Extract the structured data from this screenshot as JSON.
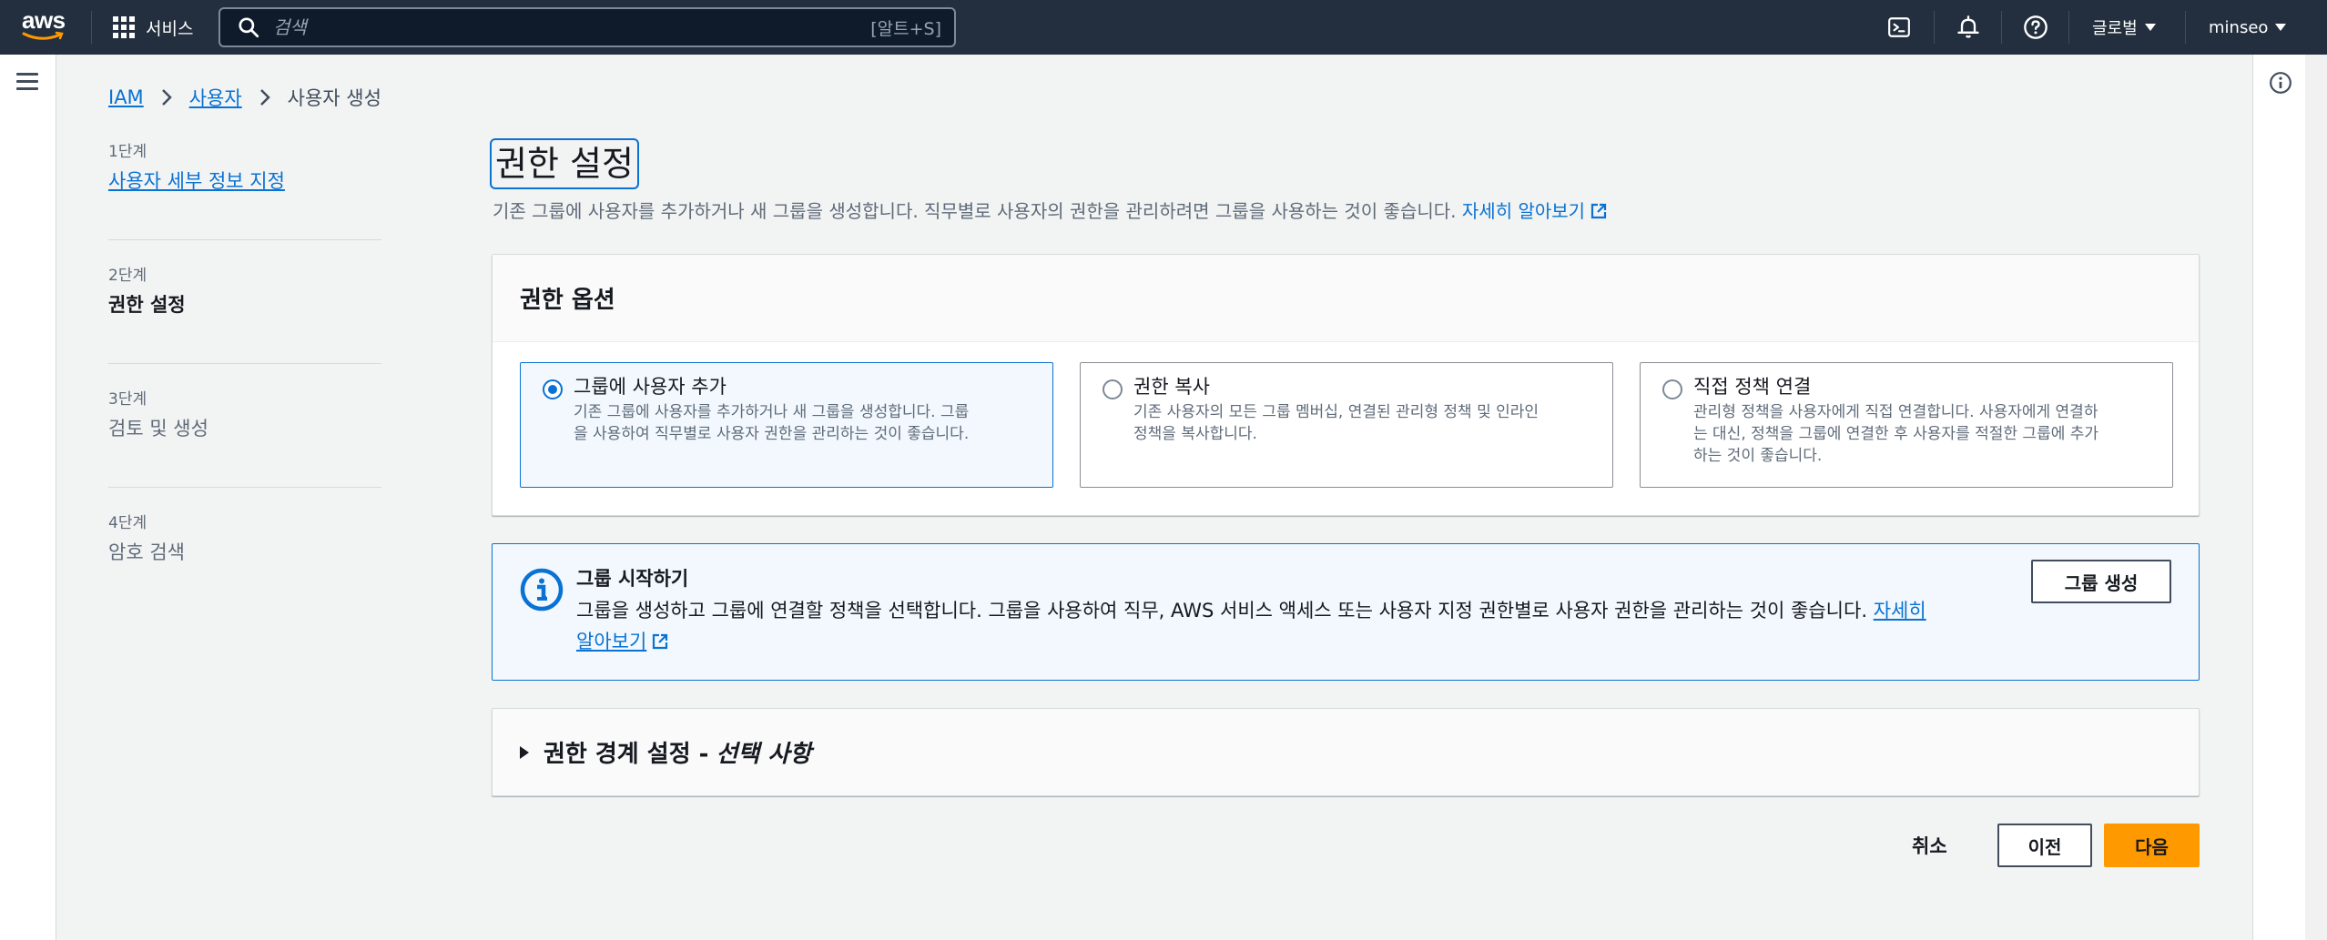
{
  "topnav": {
    "logo_text": "aws",
    "services_label": "서비스",
    "search_placeholder": "검색",
    "search_shortcut": "[알트+S]",
    "region_label": "글로벌",
    "user_label": "minseo",
    "icons": [
      "cloudshell-icon",
      "notifications-icon",
      "help-icon"
    ]
  },
  "breadcrumb": {
    "items": [
      "IAM",
      "사용자"
    ],
    "current": "사용자 생성"
  },
  "steps": [
    {
      "num": "1단계",
      "label": "사용자 세부 정보 지정"
    },
    {
      "num": "2단계",
      "label": "권한 설정"
    },
    {
      "num": "3단계",
      "label": "검토 및 생성"
    },
    {
      "num": "4단계",
      "label": "암호 검색"
    }
  ],
  "page": {
    "title": "권한 설정",
    "description": "기존 그룹에 사용자를 추가하거나 새 그룹을 생성합니다. 직무별로 사용자의 권한을 관리하려면 그룹을 사용하는 것이 좋습니다.",
    "learn_more": "자세히 알아보기"
  },
  "permission_options": {
    "header": "권한 옵션",
    "tiles": [
      {
        "title": "그룹에 사용자 추가",
        "desc_line1": "기존 그룹에 사용자를 추가하거나 새 그룹을 생성합니다. 그룹",
        "desc_line2": "을 사용하여 직무별로 사용자 권한을 관리하는 것이 좋습니다.",
        "desc_line3": "",
        "selected": true
      },
      {
        "title": "권한 복사",
        "desc_line1": "기존 사용자의 모든 그룹 멤버십, 연결된 관리형 정책 및 인라인",
        "desc_line2": "정책을 복사합니다.",
        "desc_line3": "",
        "selected": false
      },
      {
        "title": "직접 정책 연결",
        "desc_line1": "관리형 정책을 사용자에게 직접 연결합니다. 사용자에게 연결하",
        "desc_line2": "는 대신, 정책을 그룹에 연결한 후 사용자를 적절한 그룹에 추가",
        "desc_line3": "하는 것이 좋습니다.",
        "selected": false
      }
    ]
  },
  "alert": {
    "title": "그룹 시작하기",
    "body": "그룹을 생성하고 그룹에 연결할 정책을 선택합니다. 그룹을 사용하여 직무, AWS 서비스 액세스 또는 사용자 지정 권한별로 사용자 권한을 관리하는 것이 좋습니다.",
    "link_part1": "자세히",
    "link_part2": "알아보기",
    "button": "그룹 생성"
  },
  "boundary": {
    "title": "권한 경계 설정 -",
    "optional": "선택 사항"
  },
  "footer": {
    "cancel": "취소",
    "previous": "이전",
    "next": "다음"
  },
  "colors": {
    "nav_bg": "#232f3e",
    "link": "#0972d3",
    "primary_button": "#ff9900",
    "page_bg": "#f2f3f3"
  }
}
